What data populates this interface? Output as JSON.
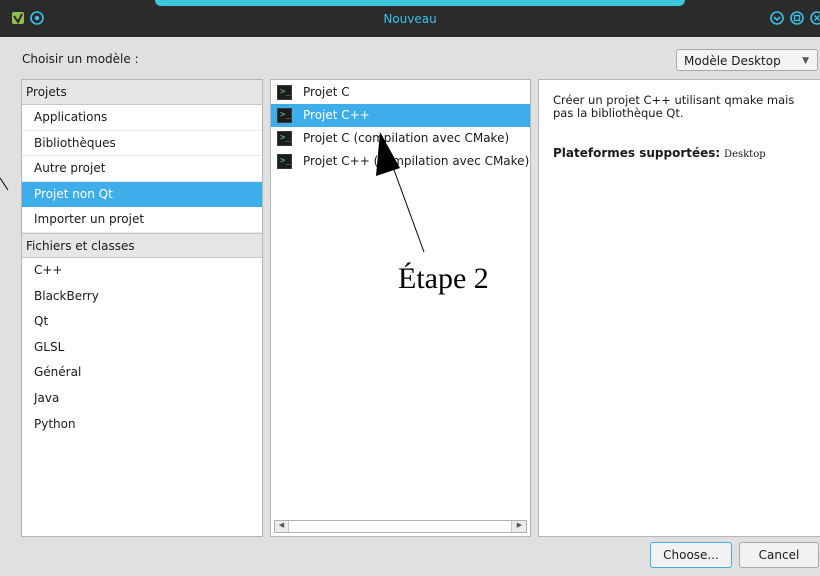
{
  "window": {
    "title": "Nouveau",
    "accent_color": "#38c2ea",
    "left_icons": [
      "app-icon",
      "pin-icon"
    ],
    "right_icons": [
      "minimize-icon",
      "maximize-icon",
      "close-icon"
    ]
  },
  "model_label": "Choisir un modèle :",
  "model_combo": {
    "selected": "Modèle Desktop"
  },
  "categories": {
    "projects_header": "Projets",
    "projects": [
      "Applications",
      "Bibliothèques",
      "Autre projet",
      "Projet non Qt",
      "Importer un projet"
    ],
    "selected_project": "Projet non Qt",
    "files_header": "Fichiers et classes",
    "files": [
      "C++",
      "BlackBerry",
      "Qt",
      "GLSL",
      "Général",
      "Java",
      "Python"
    ]
  },
  "templates": {
    "items": [
      "Projet C",
      "Projet C++",
      "Projet C (compilation avec CMake)",
      "Projet C++ (compilation avec CMake)"
    ],
    "selected": "Projet C++"
  },
  "description": {
    "text": "Créer un projet C++ utilisant qmake mais pas la bibliothèque Qt.",
    "platforms_label": "Plateformes supportées:",
    "platforms_value": "Desktop"
  },
  "buttons": {
    "choose": "Choose...",
    "cancel": "Cancel"
  },
  "annotation": {
    "label": "Étape 2"
  },
  "colors": {
    "selection": "#3daee9",
    "titlebar": "#2b2b2b"
  }
}
